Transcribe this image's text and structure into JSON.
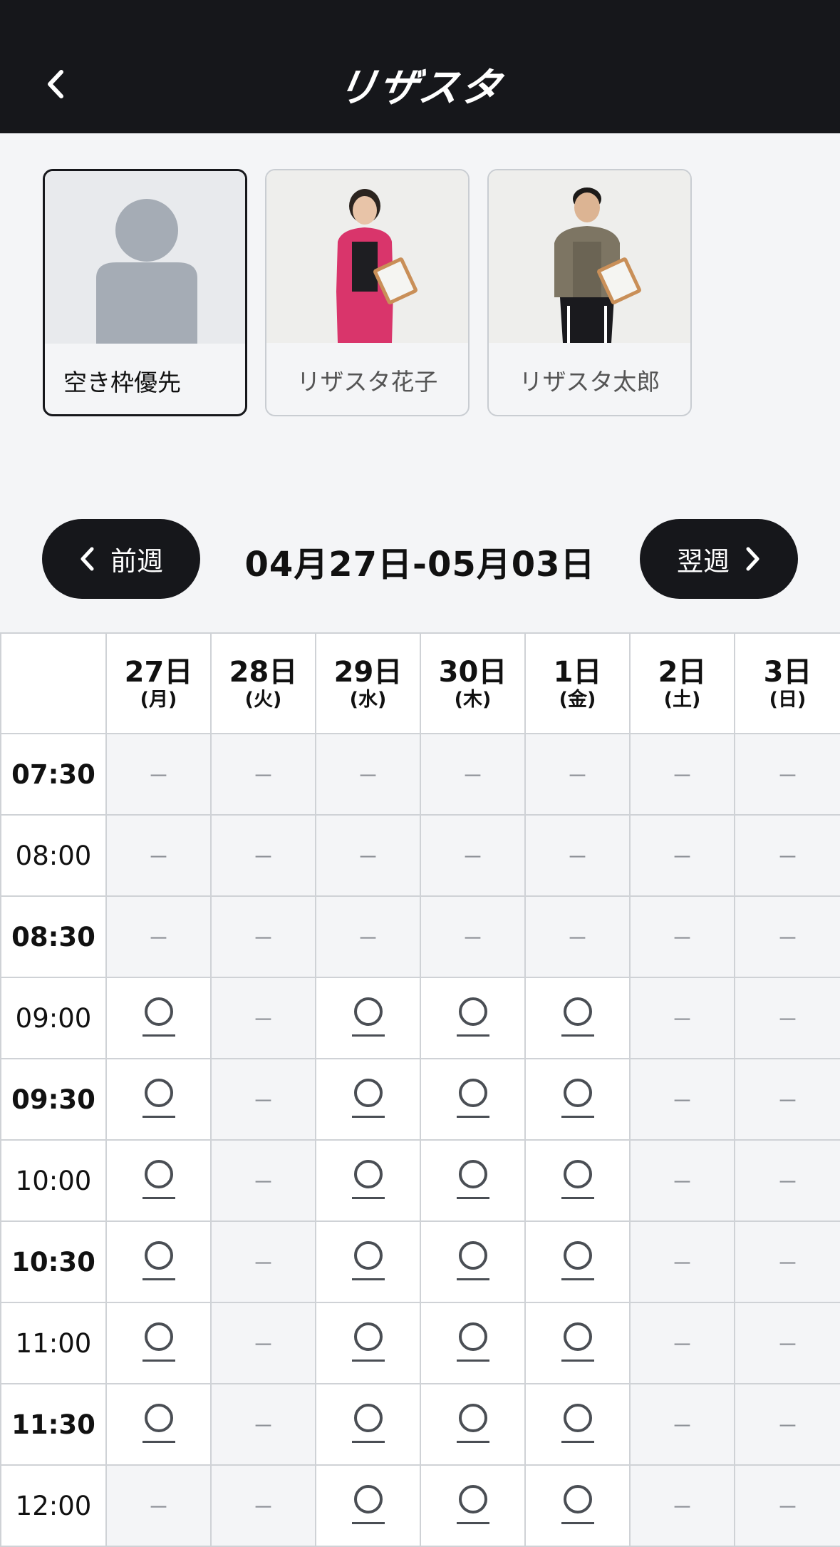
{
  "header": {
    "logo": "リザスタ",
    "back_icon": "chevron-left-icon"
  },
  "staff": [
    {
      "name": "空き枠優先",
      "selected": true,
      "image": "placeholder-person-icon"
    },
    {
      "name": "リザスタ花子",
      "selected": false,
      "image": "trainer-photo-female"
    },
    {
      "name": "リザスタ太郎",
      "selected": false,
      "image": "trainer-photo-male"
    }
  ],
  "week": {
    "prev_label": "前週",
    "range": "04月27日-05月03日",
    "next_label": "翌週"
  },
  "days": [
    {
      "num": "27日",
      "wk": "(月)"
    },
    {
      "num": "28日",
      "wk": "(火)"
    },
    {
      "num": "29日",
      "wk": "(水)"
    },
    {
      "num": "30日",
      "wk": "(木)"
    },
    {
      "num": "1日",
      "wk": "(金)"
    },
    {
      "num": "2日",
      "wk": "(土)"
    },
    {
      "num": "3日",
      "wk": "(日)"
    }
  ],
  "symbols": {
    "available": "○",
    "unavailable": "－"
  },
  "rows": [
    {
      "time": "07:30",
      "bold": true,
      "slots": [
        "-",
        "-",
        "-",
        "-",
        "-",
        "-",
        "-"
      ]
    },
    {
      "time": "08:00",
      "bold": false,
      "slots": [
        "-",
        "-",
        "-",
        "-",
        "-",
        "-",
        "-"
      ]
    },
    {
      "time": "08:30",
      "bold": true,
      "slots": [
        "-",
        "-",
        "-",
        "-",
        "-",
        "-",
        "-"
      ]
    },
    {
      "time": "09:00",
      "bold": false,
      "slots": [
        "o",
        "-",
        "o",
        "o",
        "o",
        "-",
        "-"
      ]
    },
    {
      "time": "09:30",
      "bold": true,
      "slots": [
        "o",
        "-",
        "o",
        "o",
        "o",
        "-",
        "-"
      ]
    },
    {
      "time": "10:00",
      "bold": false,
      "slots": [
        "o",
        "-",
        "o",
        "o",
        "o",
        "-",
        "-"
      ]
    },
    {
      "time": "10:30",
      "bold": true,
      "slots": [
        "o",
        "-",
        "o",
        "o",
        "o",
        "-",
        "-"
      ]
    },
    {
      "time": "11:00",
      "bold": false,
      "slots": [
        "o",
        "-",
        "o",
        "o",
        "o",
        "-",
        "-"
      ]
    },
    {
      "time": "11:30",
      "bold": true,
      "slots": [
        "o",
        "-",
        "o",
        "o",
        "o",
        "-",
        "-"
      ]
    },
    {
      "time": "12:00",
      "bold": false,
      "slots": [
        "-",
        "-",
        "o",
        "o",
        "o",
        "-",
        "-"
      ]
    }
  ]
}
